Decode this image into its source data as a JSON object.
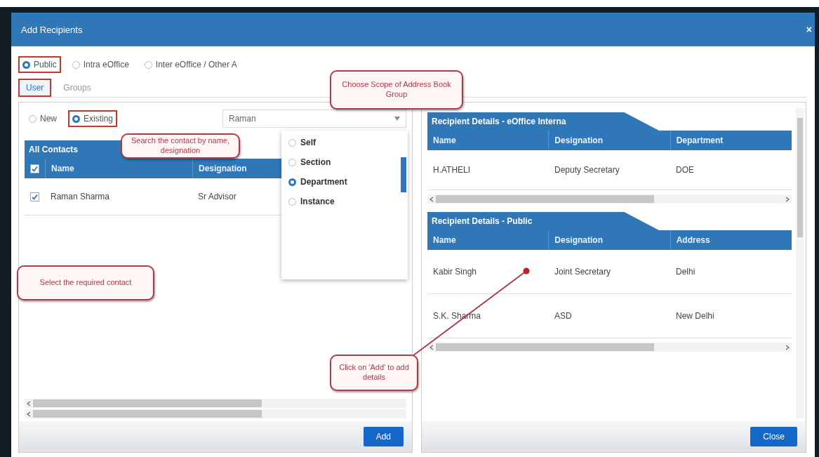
{
  "window": {
    "title": "Add Recipients",
    "close_glyph": "×"
  },
  "scope_options": [
    {
      "label": "Public",
      "selected": true,
      "highlighted": true
    },
    {
      "label": "Intra eOffice",
      "selected": false,
      "highlighted": false
    },
    {
      "label": "Inter eOffice / Other A",
      "selected": false,
      "highlighted": false
    }
  ],
  "tabs": [
    {
      "label": "User",
      "selected": true,
      "highlighted": true
    },
    {
      "label": "Groups",
      "selected": false,
      "highlighted": false
    }
  ],
  "contact_modes": [
    {
      "label": "New",
      "selected": false,
      "highlighted": false
    },
    {
      "label": "Existing",
      "selected": true,
      "highlighted": true
    }
  ],
  "search": {
    "value": "Raman"
  },
  "dropdown_options": [
    {
      "label": "Self",
      "selected": false
    },
    {
      "label": "Section",
      "selected": false
    },
    {
      "label": "Department",
      "selected": true
    },
    {
      "label": "Instance",
      "selected": false
    }
  ],
  "contacts": {
    "title": "All Contacts",
    "all_checked": true,
    "columns": [
      "Name",
      "Designation"
    ],
    "rows": [
      {
        "checked": true,
        "cells": [
          "Raman Sharma",
          "Sr Advisor"
        ]
      }
    ]
  },
  "add_button": "Add",
  "recipient_sections": [
    {
      "title": "Recipient Details - eOffice Interna",
      "columns": [
        "Name",
        "Designation",
        "Department"
      ],
      "rows": [
        [
          "H.ATHELI",
          "Deputy Secretary",
          "DOE"
        ]
      ]
    },
    {
      "title": "Recipient Details - Public",
      "columns": [
        "Name",
        "Designation",
        "Address"
      ],
      "rows": [
        [
          "Kabir Singh",
          "Joint Secretary",
          "Delhi"
        ],
        [
          "S.K. Sharma",
          "ASD",
          "New Delhi"
        ]
      ]
    }
  ],
  "close_button": "Close",
  "callouts": [
    {
      "kind": "scope",
      "text": "Choose Scope of Address Book Group"
    },
    {
      "kind": "search",
      "text": "Search the contact by name, designation"
    },
    {
      "kind": "select",
      "text": "Select the required contact"
    },
    {
      "kind": "add",
      "text": "Click on 'Add' to add details"
    }
  ]
}
